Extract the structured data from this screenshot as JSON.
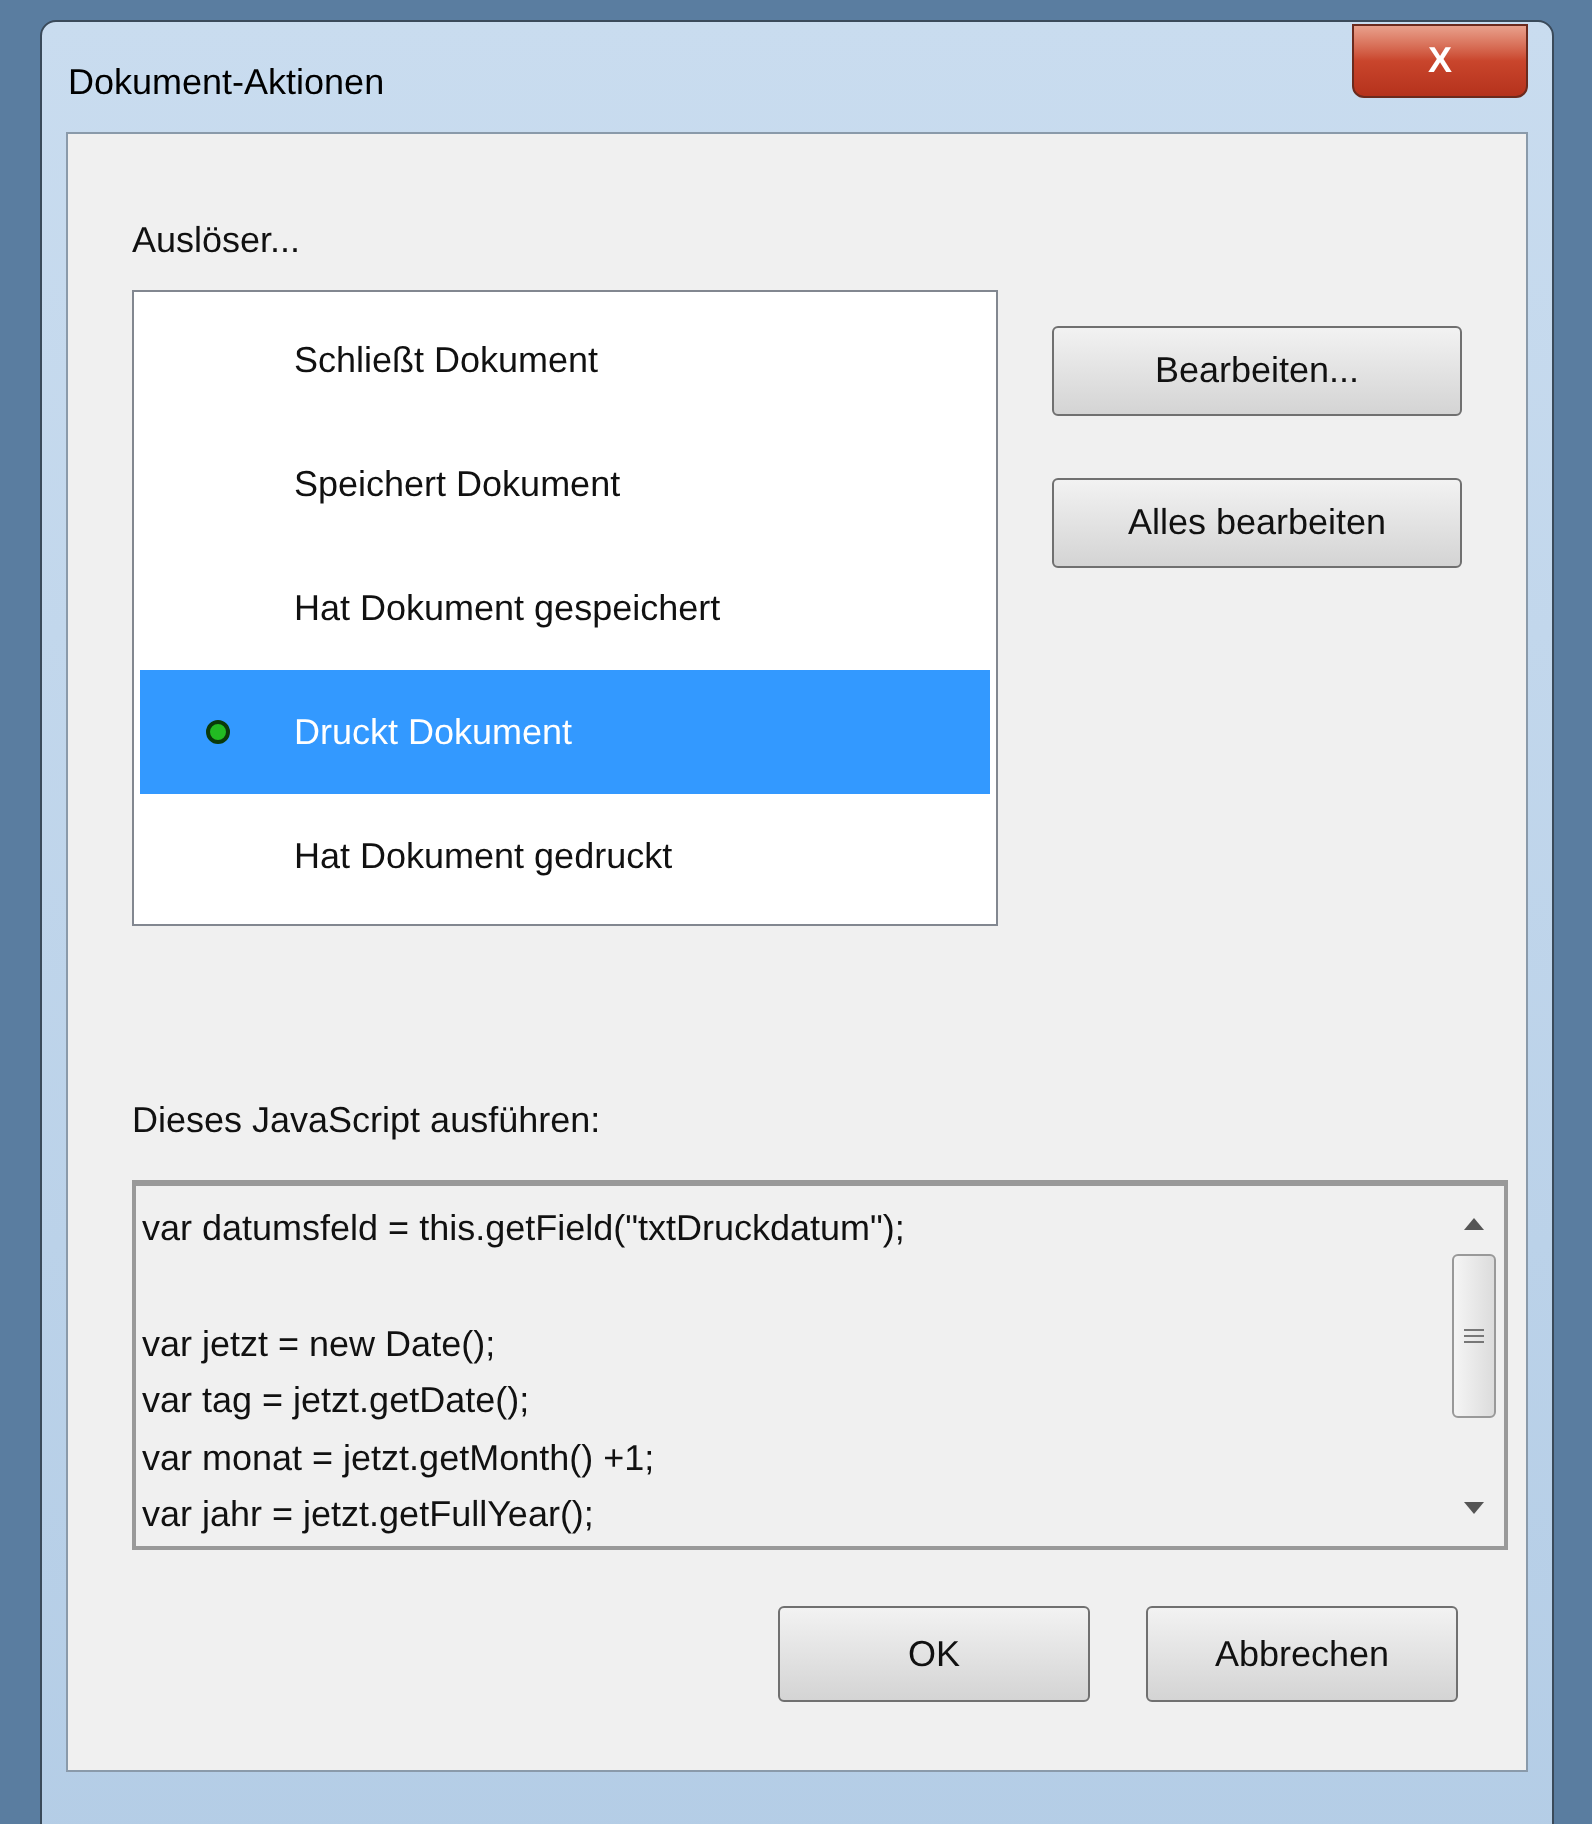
{
  "window": {
    "title": "Dokument-Aktionen",
    "close": "X"
  },
  "triggers_label": "Auslöser...",
  "triggers": [
    {
      "label": "Schließt Dokument",
      "selected": false,
      "has_action": false
    },
    {
      "label": "Speichert Dokument",
      "selected": false,
      "has_action": false
    },
    {
      "label": "Hat Dokument gespeichert",
      "selected": false,
      "has_action": false
    },
    {
      "label": "Druckt Dokument",
      "selected": true,
      "has_action": true
    },
    {
      "label": "Hat Dokument gedruckt",
      "selected": false,
      "has_action": false
    }
  ],
  "side_buttons": [
    "Bearbeiten...",
    "Alles bearbeiten"
  ],
  "script_label": "Dieses JavaScript ausführen:",
  "script_lines": [
    {
      "text": "var datumsfeld = this.getField(\"txtDruckdatum\");",
      "blank_before": false
    },
    {
      "text": "var jetzt = new Date();",
      "blank_before": true
    },
    {
      "text": "var tag = jetzt.getDate();",
      "blank_before": false
    },
    {
      "text": "var monat = jetzt.getMonth() +1;",
      "blank_before": false
    },
    {
      "text": "var jahr = jetzt.getFullYear();",
      "blank_before": false
    }
  ],
  "buttons": [
    "OK",
    "Abbrechen"
  ]
}
